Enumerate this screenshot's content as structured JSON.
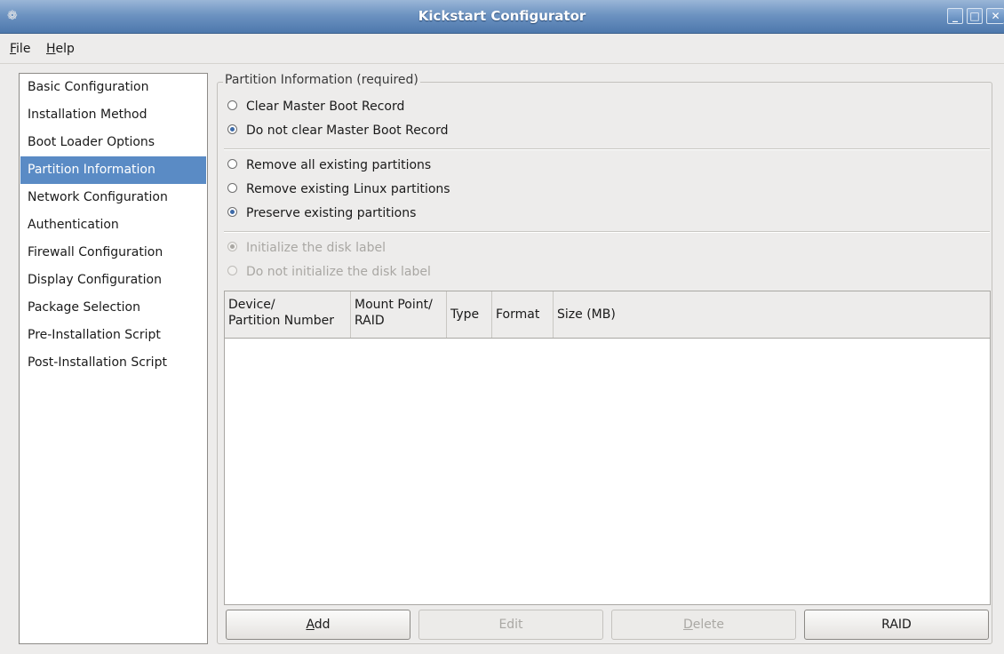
{
  "window": {
    "title": "Kickstart Configurator",
    "icon": "app-icon",
    "controls": [
      "minimize-icon",
      "maximize-icon",
      "close-icon"
    ]
  },
  "menubar": {
    "file": {
      "mnemonic": "F",
      "rest": "ile"
    },
    "help": {
      "mnemonic": "H",
      "rest": "elp"
    }
  },
  "sidebar": {
    "items": [
      {
        "label": "Basic Configuration"
      },
      {
        "label": "Installation Method"
      },
      {
        "label": "Boot Loader Options"
      },
      {
        "label": "Partition Information"
      },
      {
        "label": "Network Configuration"
      },
      {
        "label": "Authentication"
      },
      {
        "label": "Firewall Configuration"
      },
      {
        "label": "Display Configuration"
      },
      {
        "label": "Package Selection"
      },
      {
        "label": "Pre-Installation Script"
      },
      {
        "label": "Post-Installation Script"
      }
    ],
    "selected_index": 3
  },
  "partition": {
    "frame_label": "Partition Information (required)",
    "mbr": [
      {
        "label": "Clear Master Boot Record",
        "checked": false
      },
      {
        "label": "Do not clear Master Boot Record",
        "checked": true
      }
    ],
    "existing": [
      {
        "label": "Remove all existing partitions",
        "checked": false
      },
      {
        "label": "Remove existing Linux partitions",
        "checked": false
      },
      {
        "label": "Preserve existing partitions",
        "checked": true
      }
    ],
    "disk_label": [
      {
        "label": "Initialize the disk label",
        "checked": true,
        "disabled": true
      },
      {
        "label": "Do not initialize the disk label",
        "checked": false,
        "disabled": true
      }
    ],
    "table": {
      "columns": [
        {
          "line1": "Device/",
          "line2": "Partition Number"
        },
        {
          "line1": "Mount Point/",
          "line2": "RAID"
        },
        {
          "line1": "Type"
        },
        {
          "line1": "Format"
        },
        {
          "line1": "Size (MB)"
        }
      ],
      "rows": []
    },
    "buttons": {
      "add": {
        "mnemonic": "A",
        "rest": "dd"
      },
      "edit": {
        "label": "Edit"
      },
      "delete": {
        "mnemonic": "D",
        "rest": "elete"
      },
      "raid": {
        "label": "RAID"
      }
    }
  }
}
